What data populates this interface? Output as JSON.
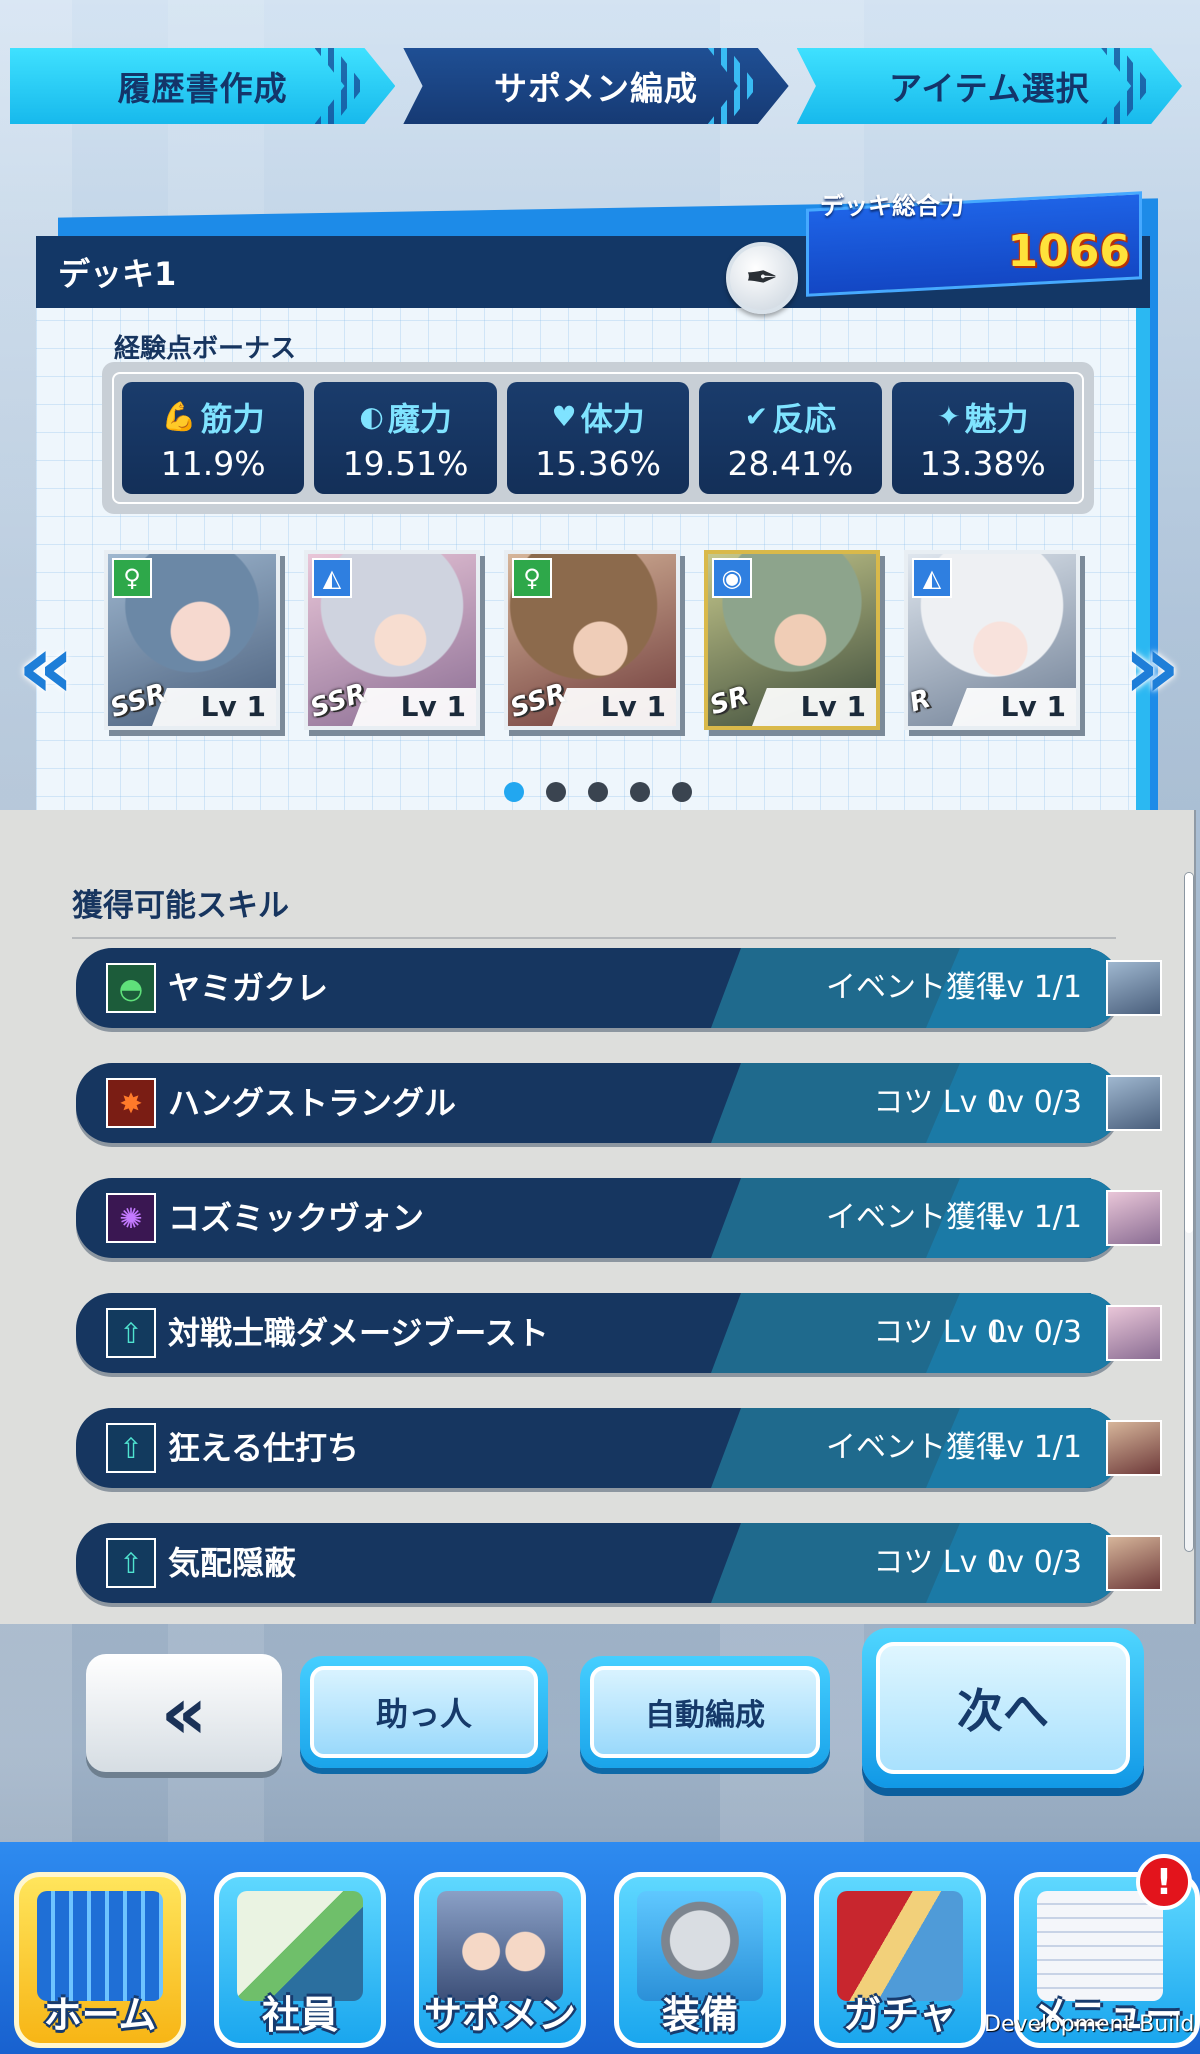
{
  "steps": [
    {
      "label": "履歴書作成"
    },
    {
      "label": "サポメン編成"
    },
    {
      "label": "アイテム選択"
    }
  ],
  "deck": {
    "name": "デッキ1",
    "power_label": "デッキ総合力",
    "power_value": "1066"
  },
  "bonus": {
    "title": "経験点ボーナス",
    "stats": [
      {
        "name": "筋力",
        "value": "11.9%",
        "icon": "muscle-icon"
      },
      {
        "name": "魔力",
        "value": "19.51%",
        "icon": "magic-icon"
      },
      {
        "name": "体力",
        "value": "15.36%",
        "icon": "heart-icon"
      },
      {
        "name": "反応",
        "value": "28.41%",
        "icon": "reaction-icon"
      },
      {
        "name": "魅力",
        "value": "13.38%",
        "icon": "sparkle-icon"
      }
    ]
  },
  "cards": [
    {
      "rank": "SSR",
      "level": "Lv 1",
      "type_icon": "venus-icon"
    },
    {
      "rank": "SSR",
      "level": "Lv 1",
      "type_icon": "sail-icon"
    },
    {
      "rank": "SSR",
      "level": "Lv 1",
      "type_icon": "venus-icon"
    },
    {
      "rank": "SR",
      "level": "Lv 1",
      "type_icon": "eye-icon"
    },
    {
      "rank": "R",
      "level": "Lv 1",
      "type_icon": "sail-icon"
    }
  ],
  "pager": {
    "count": 5,
    "active": 0
  },
  "skills": {
    "title": "獲得可能スキル",
    "rows": [
      {
        "name": "ヤミガクレ",
        "source": "イベント獲得",
        "level": "Lv 1/1"
      },
      {
        "name": "ハングストラングル",
        "source": "コツ Lv 0",
        "level": "Lv 0/3"
      },
      {
        "name": "コズミックヴォン",
        "source": "イベント獲得",
        "level": "Lv 1/1"
      },
      {
        "name": "対戦士職ダメージブースト",
        "source": "コツ Lv 0",
        "level": "Lv 0/3"
      },
      {
        "name": "狂える仕打ち",
        "source": "イベント獲得",
        "level": "Lv 1/1"
      },
      {
        "name": "気配隠蔽",
        "source": "コツ Lv 0",
        "level": "Lv 0/3"
      }
    ]
  },
  "actions": {
    "back": "«",
    "helper": "助っ人",
    "auto": "自動編成",
    "next": "次へ"
  },
  "nav": {
    "items": [
      {
        "label": "ホーム"
      },
      {
        "label": "社員"
      },
      {
        "label": "サポメン"
      },
      {
        "label": "装備"
      },
      {
        "label": "ガチャ"
      },
      {
        "label": "メニュー"
      }
    ],
    "badge": "!"
  },
  "footer_note": "Development Build",
  "colors": {
    "accent": "#1aa6ee",
    "navy": "#133766",
    "power": "#ffe23b"
  }
}
